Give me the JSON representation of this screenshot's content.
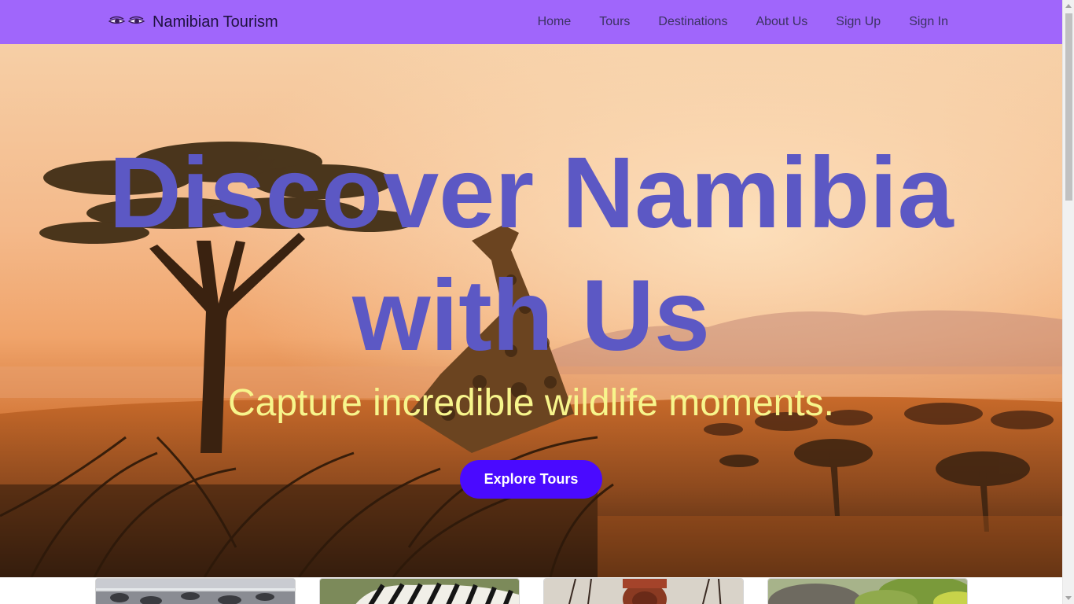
{
  "navbar": {
    "brand_text": "Namibian Tourism",
    "logo_icon": "eyes-logo-icon",
    "links": [
      {
        "label": "Home"
      },
      {
        "label": "Tours"
      },
      {
        "label": "Destinations"
      },
      {
        "label": "About Us"
      },
      {
        "label": "Sign Up"
      },
      {
        "label": "Sign In"
      }
    ],
    "background": "#a066fb"
  },
  "hero": {
    "title_line1": "Discover Namibia",
    "title_line2": "with Us",
    "subtitle": "Capture incredible wildlife moments.",
    "cta_label": "Explore Tours",
    "background_image": "savanna-giraffe-sunset",
    "title_color": "#5c58c4",
    "subtitle_color": "#f7f58c",
    "cta_color": "#4a0aff"
  },
  "cards": [
    {
      "image": "seals-coast"
    },
    {
      "image": "zebras"
    },
    {
      "image": "himba-woman"
    },
    {
      "image": "elephant-bush"
    }
  ]
}
